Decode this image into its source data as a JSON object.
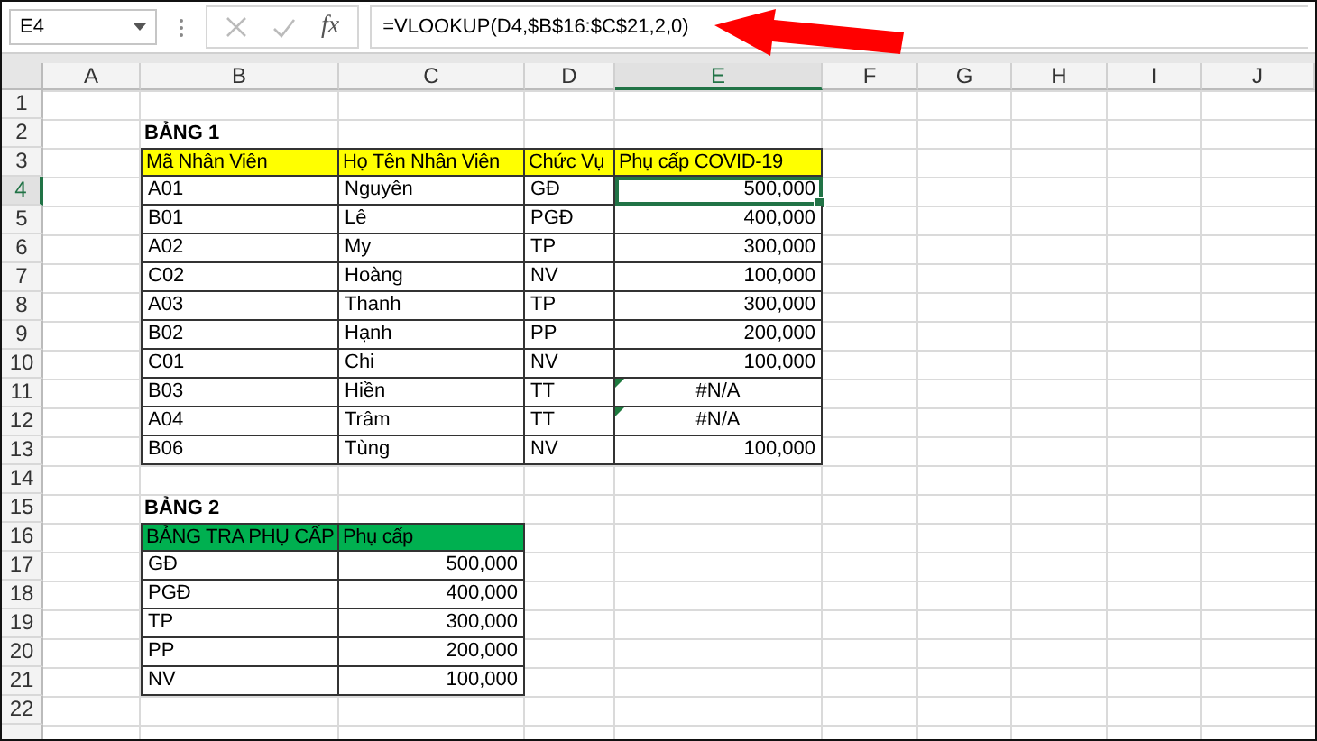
{
  "name_box": "E4",
  "fx": "fx",
  "formula": "=VLOOKUP(D4,$B$16:$C$21,2,0)",
  "columns": [
    {
      "label": "A",
      "selected": false
    },
    {
      "label": "B",
      "selected": false
    },
    {
      "label": "C",
      "selected": false
    },
    {
      "label": "D",
      "selected": false
    },
    {
      "label": "E",
      "selected": true
    },
    {
      "label": "F",
      "selected": false
    },
    {
      "label": "G",
      "selected": false
    },
    {
      "label": "H",
      "selected": false
    },
    {
      "label": "I",
      "selected": false
    },
    {
      "label": "J",
      "selected": false
    }
  ],
  "rows": [
    {
      "label": "1",
      "selected": false
    },
    {
      "label": "2",
      "selected": false
    },
    {
      "label": "3",
      "selected": false
    },
    {
      "label": "4",
      "selected": true
    },
    {
      "label": "5",
      "selected": false
    },
    {
      "label": "6",
      "selected": false
    },
    {
      "label": "7",
      "selected": false
    },
    {
      "label": "8",
      "selected": false
    },
    {
      "label": "9",
      "selected": false
    },
    {
      "label": "10",
      "selected": false
    },
    {
      "label": "11",
      "selected": false
    },
    {
      "label": "12",
      "selected": false
    },
    {
      "label": "13",
      "selected": false
    },
    {
      "label": "14",
      "selected": false
    },
    {
      "label": "15",
      "selected": false
    },
    {
      "label": "16",
      "selected": false
    },
    {
      "label": "17",
      "selected": false
    },
    {
      "label": "18",
      "selected": false
    },
    {
      "label": "19",
      "selected": false
    },
    {
      "label": "20",
      "selected": false
    },
    {
      "label": "21",
      "selected": false
    },
    {
      "label": "22",
      "selected": false
    }
  ],
  "table1": {
    "title": "BẢNG 1",
    "color": "#ffff00",
    "headers": [
      "Mã Nhân Viên",
      "Họ Tên Nhân Viên",
      "Chức Vụ",
      "Phụ cấp COVID-19"
    ],
    "rows": [
      {
        "cells": [
          "A01",
          "Nguyên",
          "GĐ"
        ],
        "allowance": {
          "text": "500,000",
          "kind": "number",
          "selected": true
        }
      },
      {
        "cells": [
          "B01",
          "Lê",
          "PGĐ"
        ],
        "allowance": {
          "text": "400,000",
          "kind": "number",
          "selected": false
        }
      },
      {
        "cells": [
          "A02",
          "My",
          "TP"
        ],
        "allowance": {
          "text": "300,000",
          "kind": "number",
          "selected": false
        }
      },
      {
        "cells": [
          "C02",
          "Hoàng",
          "NV"
        ],
        "allowance": {
          "text": "100,000",
          "kind": "number",
          "selected": false
        }
      },
      {
        "cells": [
          "A03",
          "Thanh",
          "TP"
        ],
        "allowance": {
          "text": "300,000",
          "kind": "number",
          "selected": false
        }
      },
      {
        "cells": [
          "B02",
          "Hạnh",
          "PP"
        ],
        "allowance": {
          "text": "200,000",
          "kind": "number",
          "selected": false
        }
      },
      {
        "cells": [
          "C01",
          "Chi",
          "NV"
        ],
        "allowance": {
          "text": "100,000",
          "kind": "number",
          "selected": false
        }
      },
      {
        "cells": [
          "B03",
          "Hiền",
          "TT"
        ],
        "allowance": {
          "text": "#N/A",
          "kind": "error",
          "selected": false
        }
      },
      {
        "cells": [
          "A04",
          "Trâm",
          "TT"
        ],
        "allowance": {
          "text": "#N/A",
          "kind": "error",
          "selected": false
        }
      },
      {
        "cells": [
          "B06",
          "Tùng",
          "NV"
        ],
        "allowance": {
          "text": "100,000",
          "kind": "number",
          "selected": false
        }
      }
    ]
  },
  "table2": {
    "title": "BẢNG 2",
    "color": "#00b050",
    "headers": [
      "BẢNG TRA PHỤ CẤP",
      "Phụ cấp"
    ],
    "rows": [
      {
        "cells": [
          "GĐ",
          "500,000"
        ]
      },
      {
        "cells": [
          "PGĐ",
          "400,000"
        ]
      },
      {
        "cells": [
          "TP",
          "300,000"
        ]
      },
      {
        "cells": [
          "PP",
          "200,000"
        ]
      },
      {
        "cells": [
          "NV",
          "100,000"
        ]
      }
    ]
  }
}
